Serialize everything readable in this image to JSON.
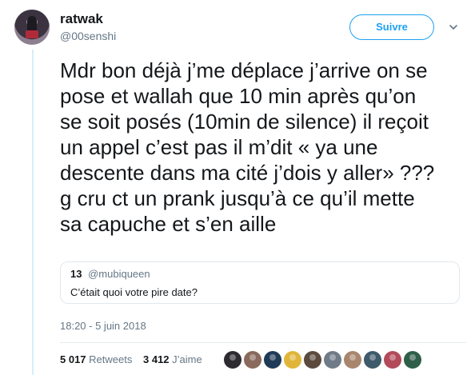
{
  "tweet": {
    "author_name": "ratwak",
    "author_handle": "@00senshi",
    "follow_label": "Suivre",
    "text": "Mdr bon déjà j’me déplace j’arrive on se\npose et wallah que 10 min après qu’on\nse soit posés (10min de silence) il reçoit\nun appel c’est pas il m’dit « ya une\ndescente dans ma cité j’dois y aller» ???\ng cru ct un prank jusqu’à ce qu’il mette\nsa capuche et s’en aille",
    "timestamp": "18:20 - 5 juin 2018"
  },
  "quoted": {
    "name": "13",
    "handle": "@mubiqueen",
    "text": "C’était quoi votre pire date?"
  },
  "stats": {
    "retweets_count": "5 017",
    "retweets_label": "Retweets",
    "likes_count": "3 412",
    "likes_label": "J’aime"
  },
  "likers": [
    {
      "name": "liker-avatar",
      "color": "#2d2a30"
    },
    {
      "name": "liker-avatar",
      "color": "#8a6a5c"
    },
    {
      "name": "liker-avatar",
      "color": "#1f3b57"
    },
    {
      "name": "liker-avatar",
      "color": "#e0b53a"
    },
    {
      "name": "liker-avatar",
      "color": "#5b4a3e"
    },
    {
      "name": "liker-avatar",
      "color": "#6f7b86"
    },
    {
      "name": "liker-avatar",
      "color": "#a8866d"
    },
    {
      "name": "liker-avatar",
      "color": "#3e5a6b"
    },
    {
      "name": "liker-avatar",
      "color": "#b24a5a"
    },
    {
      "name": "liker-avatar",
      "color": "#2f5f4a"
    }
  ],
  "colors": {
    "accent": "#1da1f2",
    "muted": "#657786",
    "thread_line": "#d4eef9"
  }
}
